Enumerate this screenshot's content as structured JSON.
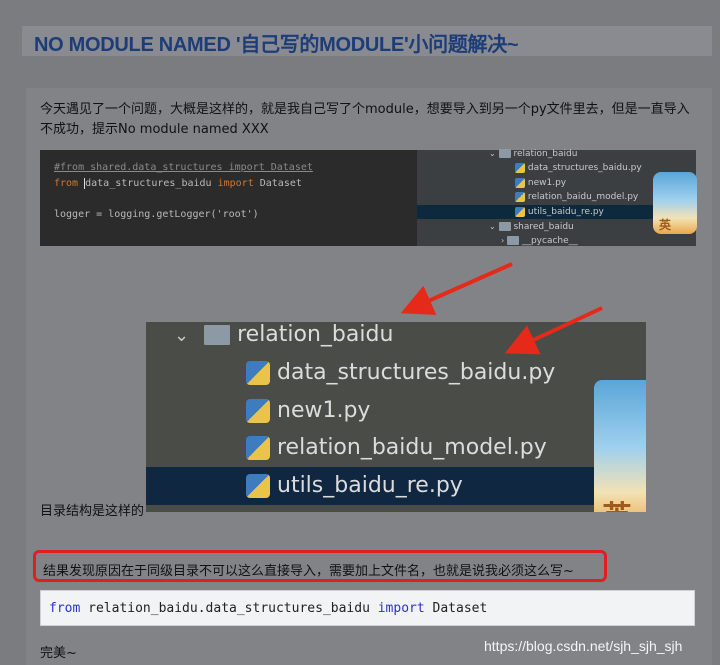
{
  "title": "NO MODULE NAMED '自己写的MODULE'小问题解决~",
  "intro": "今天遇见了一个问题，大概是这样的，就是我自己写了个module，想要导入到另一个py文件里去，但是一直导入不成功，提示No module named XXX",
  "editor": {
    "line1": "#from shared.data_structures import Dataset",
    "line2_kw": "from",
    "line2_mod": "data_structures_baidu",
    "line2_kw2": "import",
    "line2_name": "Dataset",
    "line3": "logger = logging.getLogger('root')"
  },
  "tree_small": {
    "folder": "relation_baidu",
    "files": [
      "data_structures_baidu.py",
      "new1.py",
      "relation_baidu_model.py",
      "utils_baidu_re.py"
    ],
    "folder2": "shared_baidu",
    "sub": "__pycache__"
  },
  "tree_zoom": {
    "folder": "relation_baidu",
    "files": [
      "data_structures_baidu.py",
      "new1.py",
      "relation_baidu_model.py",
      "utils_baidu_re.py"
    ]
  },
  "badge_char": "英",
  "dir_caption": "目录结构是这样的",
  "conclusion": "结果发现原因在于同级目录不可以这么直接导入，需要加上文件名，也就是说我必须这么写~",
  "fix_code": {
    "kw_from": "from",
    "module": "relation_baidu.data_structures_baidu",
    "kw_import": "import",
    "name": "Dataset"
  },
  "ending": "完美~",
  "watermark": "https://blog.csdn.net/sjh_sjh_sjh",
  "colors": {
    "title": "#1d3d78",
    "highlight_border": "#e02020",
    "arrow": "#e52a1a",
    "keyword": "#2a34c4"
  }
}
